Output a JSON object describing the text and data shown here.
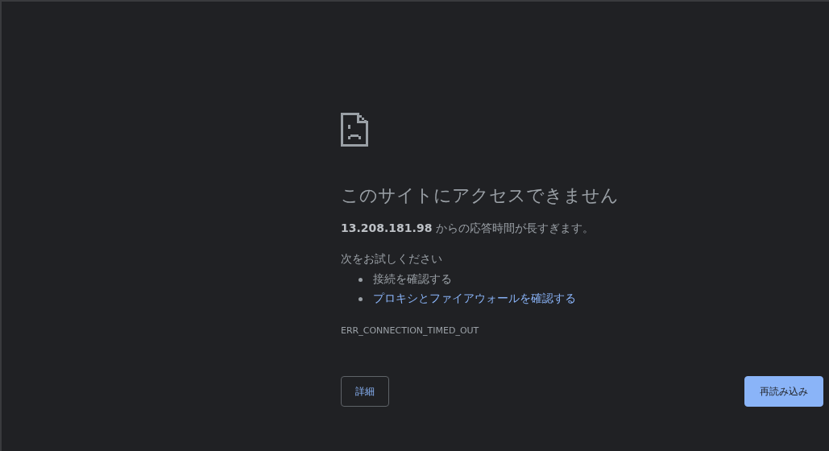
{
  "heading": "このサイトにアクセスできません",
  "message": "**13.208.181.98** からの応答時間が長すぎます。",
  "suggestions_title": "次をお試しください",
  "suggestions": [
    {
      "kind": "text",
      "label": "接続を確認する"
    },
    {
      "kind": "link",
      "label": "プロキシとファイアウォールを確認する"
    }
  ],
  "error_code": "ERR_CONNECTION_TIMED_OUT",
  "buttons": [
    {
      "kind": "secondary",
      "label": "詳細"
    },
    {
      "kind": "primary",
      "label": "再読み込み"
    }
  ]
}
